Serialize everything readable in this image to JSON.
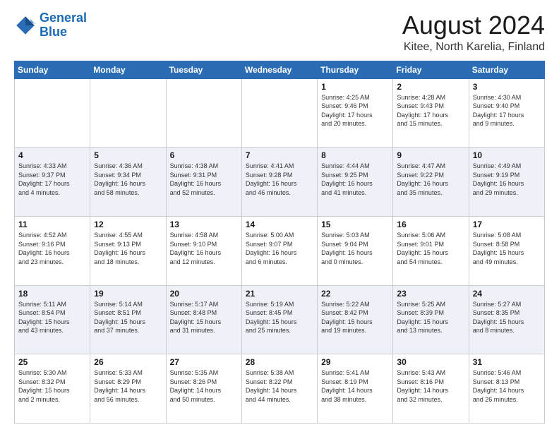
{
  "header": {
    "logo_line1": "General",
    "logo_line2": "Blue",
    "title": "August 2024",
    "subtitle": "Kitee, North Karelia, Finland"
  },
  "weekdays": [
    "Sunday",
    "Monday",
    "Tuesday",
    "Wednesday",
    "Thursday",
    "Friday",
    "Saturday"
  ],
  "weeks": [
    [
      {
        "day": "",
        "info": ""
      },
      {
        "day": "",
        "info": ""
      },
      {
        "day": "",
        "info": ""
      },
      {
        "day": "",
        "info": ""
      },
      {
        "day": "1",
        "info": "Sunrise: 4:25 AM\nSunset: 9:46 PM\nDaylight: 17 hours\nand 20 minutes."
      },
      {
        "day": "2",
        "info": "Sunrise: 4:28 AM\nSunset: 9:43 PM\nDaylight: 17 hours\nand 15 minutes."
      },
      {
        "day": "3",
        "info": "Sunrise: 4:30 AM\nSunset: 9:40 PM\nDaylight: 17 hours\nand 9 minutes."
      }
    ],
    [
      {
        "day": "4",
        "info": "Sunrise: 4:33 AM\nSunset: 9:37 PM\nDaylight: 17 hours\nand 4 minutes."
      },
      {
        "day": "5",
        "info": "Sunrise: 4:36 AM\nSunset: 9:34 PM\nDaylight: 16 hours\nand 58 minutes."
      },
      {
        "day": "6",
        "info": "Sunrise: 4:38 AM\nSunset: 9:31 PM\nDaylight: 16 hours\nand 52 minutes."
      },
      {
        "day": "7",
        "info": "Sunrise: 4:41 AM\nSunset: 9:28 PM\nDaylight: 16 hours\nand 46 minutes."
      },
      {
        "day": "8",
        "info": "Sunrise: 4:44 AM\nSunset: 9:25 PM\nDaylight: 16 hours\nand 41 minutes."
      },
      {
        "day": "9",
        "info": "Sunrise: 4:47 AM\nSunset: 9:22 PM\nDaylight: 16 hours\nand 35 minutes."
      },
      {
        "day": "10",
        "info": "Sunrise: 4:49 AM\nSunset: 9:19 PM\nDaylight: 16 hours\nand 29 minutes."
      }
    ],
    [
      {
        "day": "11",
        "info": "Sunrise: 4:52 AM\nSunset: 9:16 PM\nDaylight: 16 hours\nand 23 minutes."
      },
      {
        "day": "12",
        "info": "Sunrise: 4:55 AM\nSunset: 9:13 PM\nDaylight: 16 hours\nand 18 minutes."
      },
      {
        "day": "13",
        "info": "Sunrise: 4:58 AM\nSunset: 9:10 PM\nDaylight: 16 hours\nand 12 minutes."
      },
      {
        "day": "14",
        "info": "Sunrise: 5:00 AM\nSunset: 9:07 PM\nDaylight: 16 hours\nand 6 minutes."
      },
      {
        "day": "15",
        "info": "Sunrise: 5:03 AM\nSunset: 9:04 PM\nDaylight: 16 hours\nand 0 minutes."
      },
      {
        "day": "16",
        "info": "Sunrise: 5:06 AM\nSunset: 9:01 PM\nDaylight: 15 hours\nand 54 minutes."
      },
      {
        "day": "17",
        "info": "Sunrise: 5:08 AM\nSunset: 8:58 PM\nDaylight: 15 hours\nand 49 minutes."
      }
    ],
    [
      {
        "day": "18",
        "info": "Sunrise: 5:11 AM\nSunset: 8:54 PM\nDaylight: 15 hours\nand 43 minutes."
      },
      {
        "day": "19",
        "info": "Sunrise: 5:14 AM\nSunset: 8:51 PM\nDaylight: 15 hours\nand 37 minutes."
      },
      {
        "day": "20",
        "info": "Sunrise: 5:17 AM\nSunset: 8:48 PM\nDaylight: 15 hours\nand 31 minutes."
      },
      {
        "day": "21",
        "info": "Sunrise: 5:19 AM\nSunset: 8:45 PM\nDaylight: 15 hours\nand 25 minutes."
      },
      {
        "day": "22",
        "info": "Sunrise: 5:22 AM\nSunset: 8:42 PM\nDaylight: 15 hours\nand 19 minutes."
      },
      {
        "day": "23",
        "info": "Sunrise: 5:25 AM\nSunset: 8:39 PM\nDaylight: 15 hours\nand 13 minutes."
      },
      {
        "day": "24",
        "info": "Sunrise: 5:27 AM\nSunset: 8:35 PM\nDaylight: 15 hours\nand 8 minutes."
      }
    ],
    [
      {
        "day": "25",
        "info": "Sunrise: 5:30 AM\nSunset: 8:32 PM\nDaylight: 15 hours\nand 2 minutes."
      },
      {
        "day": "26",
        "info": "Sunrise: 5:33 AM\nSunset: 8:29 PM\nDaylight: 14 hours\nand 56 minutes."
      },
      {
        "day": "27",
        "info": "Sunrise: 5:35 AM\nSunset: 8:26 PM\nDaylight: 14 hours\nand 50 minutes."
      },
      {
        "day": "28",
        "info": "Sunrise: 5:38 AM\nSunset: 8:22 PM\nDaylight: 14 hours\nand 44 minutes."
      },
      {
        "day": "29",
        "info": "Sunrise: 5:41 AM\nSunset: 8:19 PM\nDaylight: 14 hours\nand 38 minutes."
      },
      {
        "day": "30",
        "info": "Sunrise: 5:43 AM\nSunset: 8:16 PM\nDaylight: 14 hours\nand 32 minutes."
      },
      {
        "day": "31",
        "info": "Sunrise: 5:46 AM\nSunset: 8:13 PM\nDaylight: 14 hours\nand 26 minutes."
      }
    ]
  ]
}
